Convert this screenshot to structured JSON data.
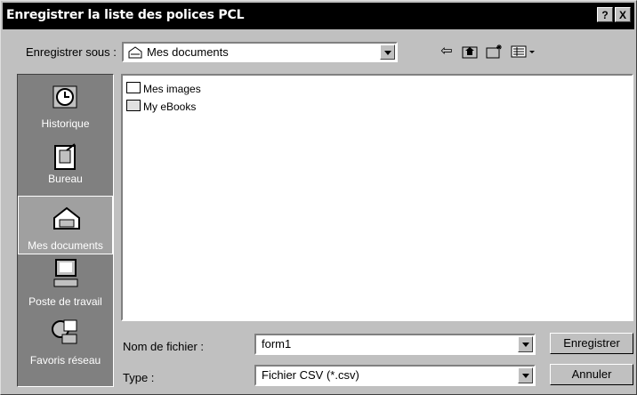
{
  "window": {
    "title": "Enregistrer la liste des polices PCL"
  },
  "title_buttons": {
    "help": "?",
    "close": "X"
  },
  "save_in": {
    "label": "Enregistrer sous :",
    "value": "Mes documents"
  },
  "toolbar": {
    "icons": [
      "back-arrow-icon",
      "up-folder-icon",
      "new-folder-icon",
      "view-menu-icon"
    ]
  },
  "places": [
    {
      "label": "Historique",
      "icon": "history-icon"
    },
    {
      "label": "Bureau",
      "icon": "desktop-icon"
    },
    {
      "label": "Mes documents",
      "icon": "my-documents-icon",
      "selected": true
    },
    {
      "label": "Poste de travail",
      "icon": "computer-icon"
    },
    {
      "label": "Favoris réseau",
      "icon": "network-icon"
    }
  ],
  "files": [
    {
      "name": "Mes images",
      "icon": "picture-folder-icon"
    },
    {
      "name": "My eBooks",
      "icon": "folder-icon"
    }
  ],
  "filename": {
    "label": "Nom de fichier :",
    "value": "form1"
  },
  "filetype": {
    "label": "Type :",
    "value": "Fichier CSV (*.csv)"
  },
  "buttons": {
    "save": "Enregistrer",
    "cancel": "Annuler"
  }
}
